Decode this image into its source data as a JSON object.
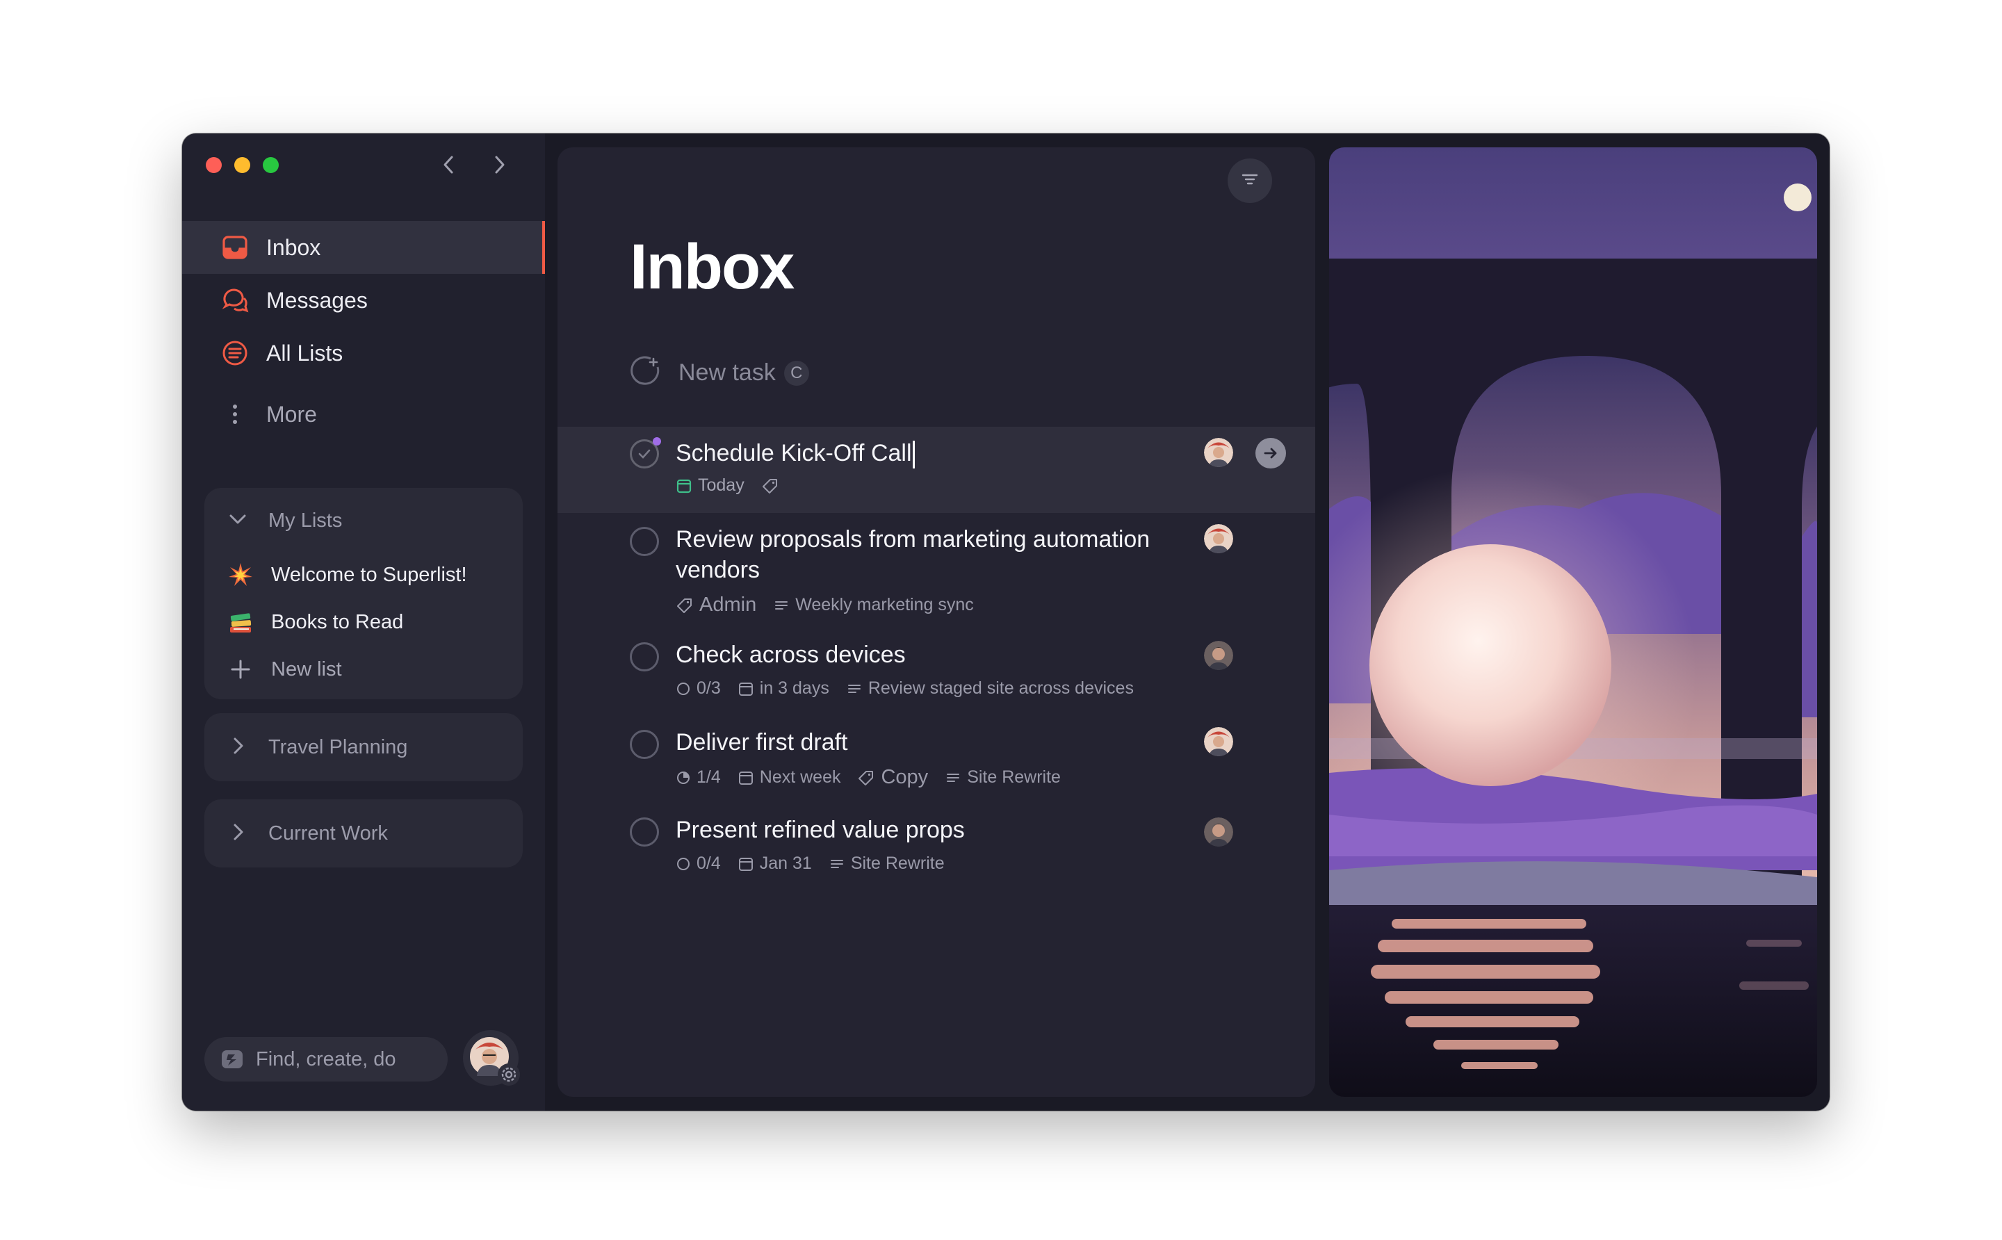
{
  "window": {
    "accent": "#ef5a45"
  },
  "sidebar": {
    "nav": [
      {
        "label": "Inbox",
        "icon": "inbox-icon",
        "active": true
      },
      {
        "label": "Messages",
        "icon": "messages-icon"
      },
      {
        "label": "All Lists",
        "icon": "all-lists-icon"
      },
      {
        "label": "More",
        "icon": "more-vertical-icon"
      }
    ],
    "my_lists": {
      "header": "My Lists",
      "items": [
        {
          "label": "Welcome to Superlist!",
          "icon": "sparkle-emoji-icon"
        },
        {
          "label": "Books to Read",
          "icon": "books-emoji-icon"
        }
      ],
      "new_list": "New list"
    },
    "groups": [
      {
        "label": "Travel Planning"
      },
      {
        "label": "Current Work"
      }
    ],
    "search": {
      "placeholder": "Find, create, do"
    }
  },
  "main": {
    "title": "Inbox",
    "new_task": {
      "placeholder": "New task",
      "shortcut": "C"
    },
    "tasks": [
      {
        "name": "Schedule Kick-Off Call",
        "meta": {
          "date": "Today"
        }
      },
      {
        "name_line1": "Review proposals from marketing automation",
        "name_line2": "vendors",
        "meta": {
          "tag": "Admin",
          "list": "Weekly marketing sync"
        }
      },
      {
        "name": "Check across devices",
        "meta": {
          "subtasks": "0/3",
          "date": "in 3 days",
          "list": "Review staged site across devices"
        }
      },
      {
        "name": "Deliver first draft",
        "meta": {
          "subtasks": "1/4",
          "date": "Next week",
          "tag": "Copy",
          "list": "Site Rewrite"
        }
      },
      {
        "name": "Present refined value props",
        "meta": {
          "subtasks": "0/4",
          "date": "Jan 31",
          "list": "Site Rewrite"
        }
      }
    ]
  }
}
